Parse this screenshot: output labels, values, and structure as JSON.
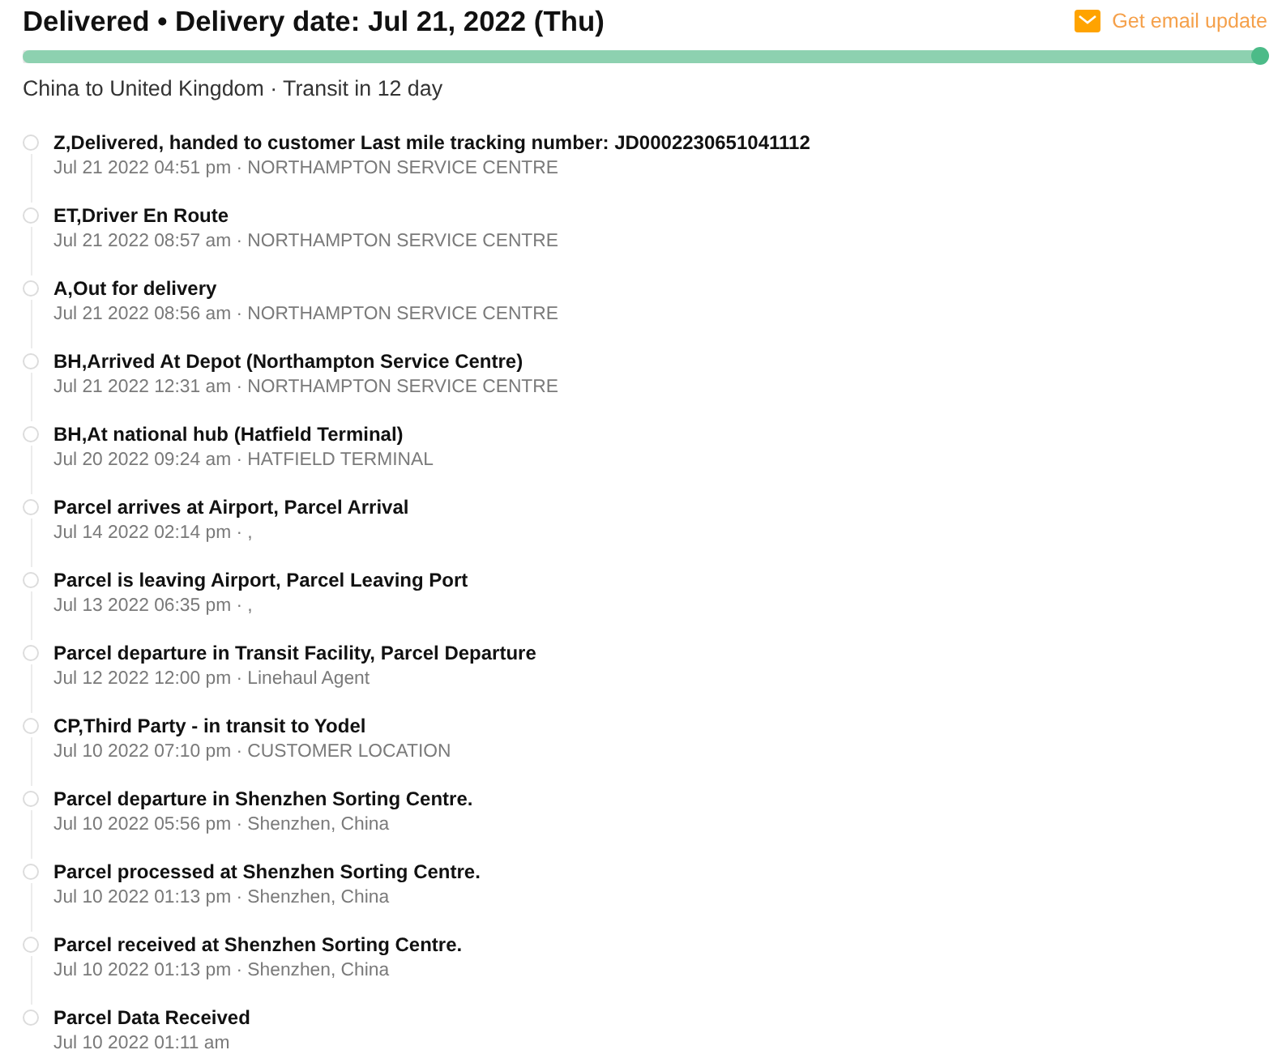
{
  "header": {
    "title": "Delivered • Delivery date: Jul 21, 2022 (Thu)",
    "email_link": "Get email update"
  },
  "progress": {
    "level": 1
  },
  "route": "China to United Kingdom · Transit in 12 day",
  "events": [
    {
      "title": "Z,Delivered, handed to customer Last mile tracking number: JD0002230651041112",
      "detail": "Jul 21 2022 04:51 pm · NORTHAMPTON SERVICE CENTRE"
    },
    {
      "title": "ET,Driver En Route",
      "detail": "Jul 21 2022 08:57 am · NORTHAMPTON SERVICE CENTRE"
    },
    {
      "title": "A,Out for delivery",
      "detail": "Jul 21 2022 08:56 am · NORTHAMPTON SERVICE CENTRE"
    },
    {
      "title": "BH,Arrived At Depot (Northampton Service Centre)",
      "detail": "Jul 21 2022 12:31 am · NORTHAMPTON SERVICE CENTRE"
    },
    {
      "title": "BH,At national hub (Hatfield Terminal)",
      "detail": "Jul 20 2022 09:24 am · HATFIELD TERMINAL"
    },
    {
      "title": "Parcel arrives at Airport, Parcel Arrival",
      "detail": "Jul 14 2022 02:14 pm · ,"
    },
    {
      "title": "Parcel is leaving Airport, Parcel Leaving Port",
      "detail": "Jul 13 2022 06:35 pm · ,"
    },
    {
      "title": "Parcel departure in Transit Facility, Parcel Departure",
      "detail": "Jul 12 2022 12:00 pm · Linehaul Agent"
    },
    {
      "title": "CP,Third Party - in transit to Yodel",
      "detail": "Jul 10 2022 07:10 pm · CUSTOMER LOCATION"
    },
    {
      "title": "Parcel departure in Shenzhen Sorting Centre.",
      "detail": "Jul 10 2022 05:56 pm · Shenzhen, China"
    },
    {
      "title": "Parcel processed at Shenzhen Sorting Centre.",
      "detail": "Jul 10 2022 01:13 pm · Shenzhen, China"
    },
    {
      "title": "Parcel received at Shenzhen Sorting Centre.",
      "detail": "Jul 10 2022 01:13 pm · Shenzhen, China"
    },
    {
      "title": "Parcel Data Received",
      "detail": "Jul 10 2022 01:11 am"
    }
  ]
}
